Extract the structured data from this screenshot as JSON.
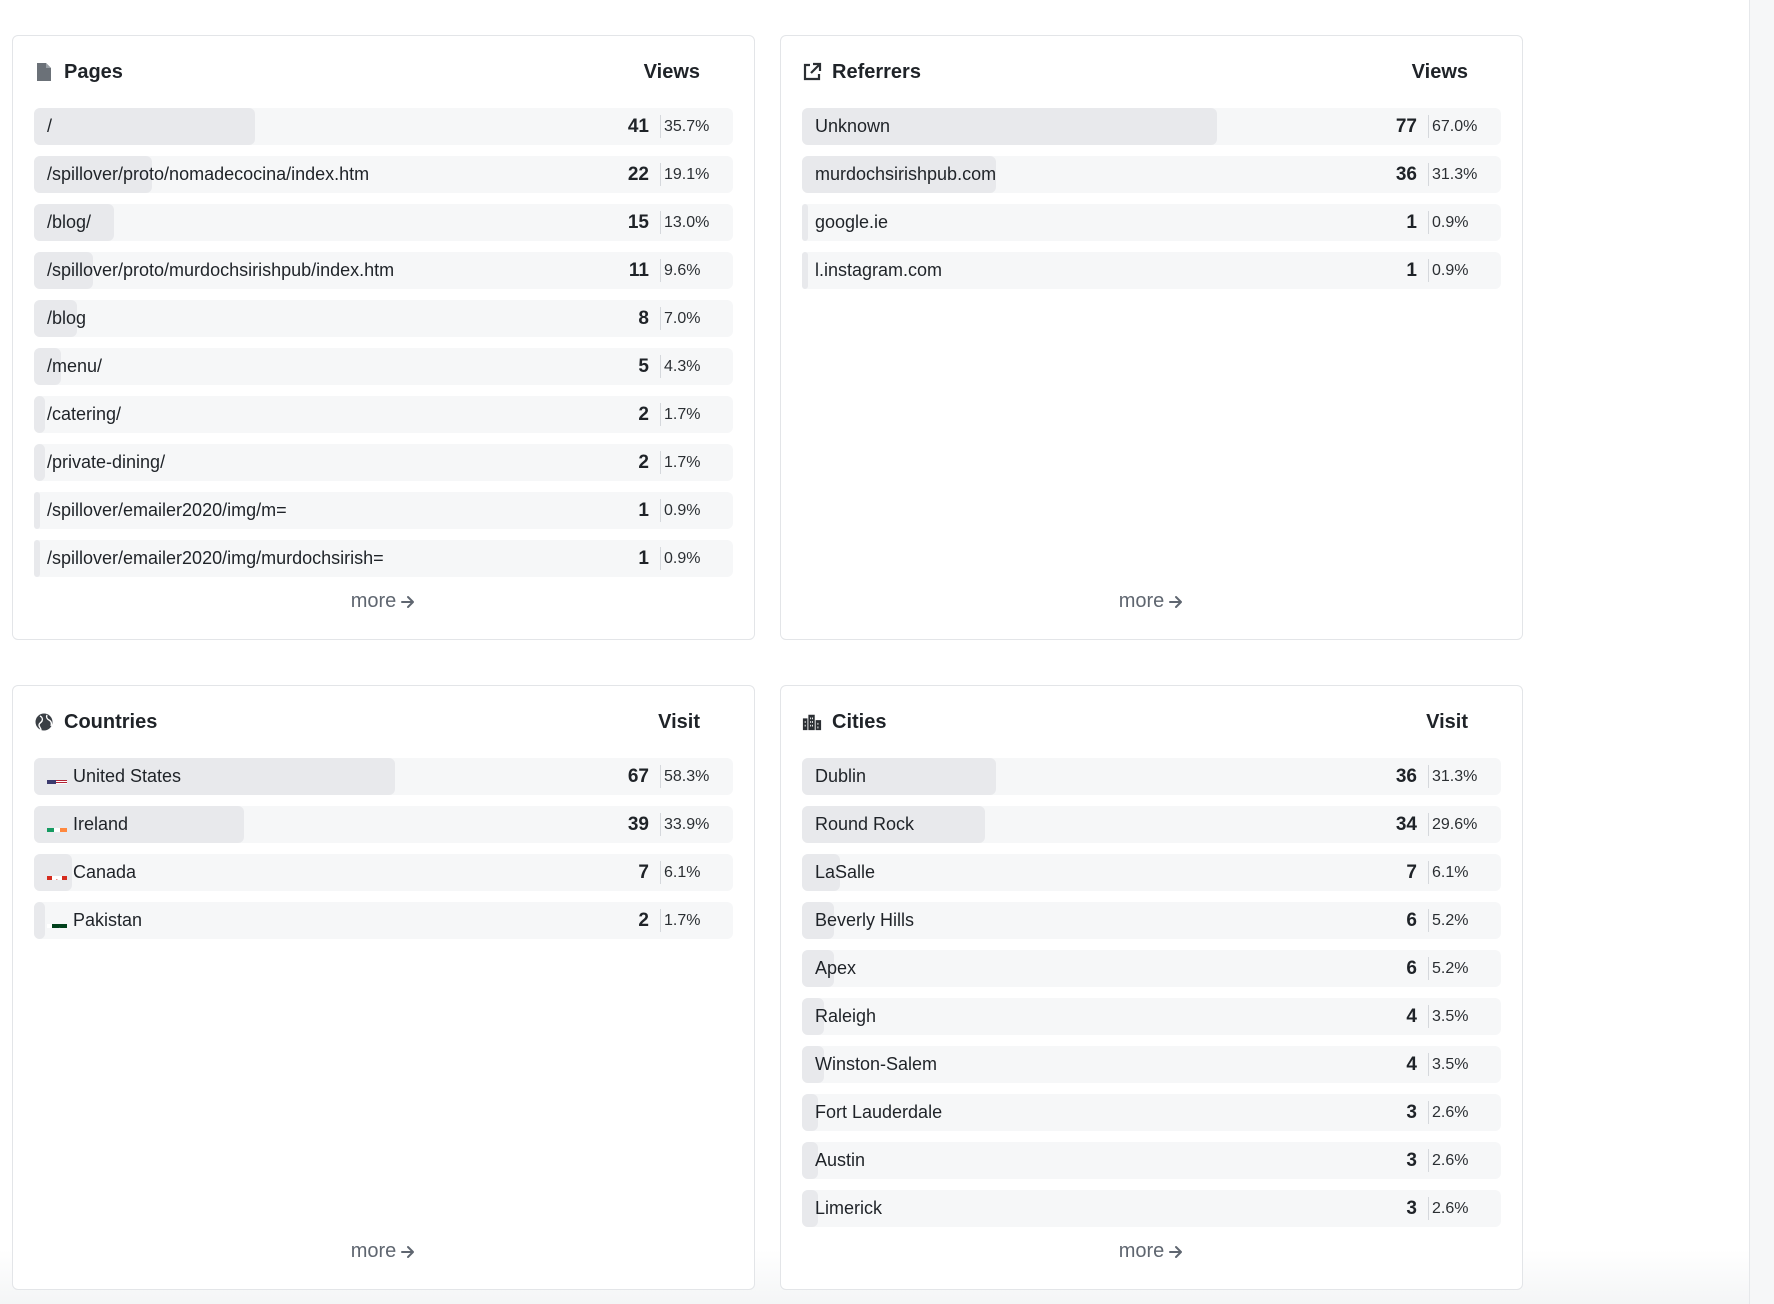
{
  "pages": {
    "title": "Pages",
    "icon": "document-icon",
    "column_label": "Views",
    "more_label": "more",
    "rows": [
      {
        "label": "/",
        "count": "41",
        "pct": "35.7%",
        "share": 0.357
      },
      {
        "label": "/spillover/proto/nomadecocina/index.htm",
        "count": "22",
        "pct": "19.1%",
        "share": 0.191
      },
      {
        "label": "/blog/",
        "count": "15",
        "pct": "13.0%",
        "share": 0.13
      },
      {
        "label": "/spillover/proto/murdochsirishpub/index.htm",
        "count": "11",
        "pct": "9.6%",
        "share": 0.096
      },
      {
        "label": "/blog",
        "count": "8",
        "pct": "7.0%",
        "share": 0.07
      },
      {
        "label": "/menu/",
        "count": "5",
        "pct": "4.3%",
        "share": 0.043
      },
      {
        "label": "/catering/",
        "count": "2",
        "pct": "1.7%",
        "share": 0.017
      },
      {
        "label": "/private-dining/",
        "count": "2",
        "pct": "1.7%",
        "share": 0.017
      },
      {
        "label": "/spillover/emailer2020/img/m=",
        "count": "1",
        "pct": "0.9%",
        "share": 0.009
      },
      {
        "label": "/spillover/emailer2020/img/murdochsirish=",
        "count": "1",
        "pct": "0.9%",
        "share": 0.009
      }
    ]
  },
  "referrers": {
    "title": "Referrers",
    "icon": "external-link-icon",
    "column_label": "Views",
    "more_label": "more",
    "rows": [
      {
        "label": "Unknown",
        "count": "77",
        "pct": "67.0%",
        "share": 0.67
      },
      {
        "label": "murdochsirishpub.com",
        "count": "36",
        "pct": "31.3%",
        "share": 0.313
      },
      {
        "label": "google.ie",
        "count": "1",
        "pct": "0.9%",
        "share": 0.009
      },
      {
        "label": "l.instagram.com",
        "count": "1",
        "pct": "0.9%",
        "share": 0.009
      }
    ]
  },
  "countries": {
    "title": "Countries",
    "icon": "globe-icon",
    "column_label": "Visit",
    "more_label": "more",
    "rows": [
      {
        "label": "United States",
        "flag": "us",
        "count": "67",
        "pct": "58.3%",
        "share": 0.583
      },
      {
        "label": "Ireland",
        "flag": "ie",
        "count": "39",
        "pct": "33.9%",
        "share": 0.339
      },
      {
        "label": "Canada",
        "flag": "ca",
        "count": "7",
        "pct": "6.1%",
        "share": 0.061
      },
      {
        "label": "Pakistan",
        "flag": "pk",
        "count": "2",
        "pct": "1.7%",
        "share": 0.017
      }
    ]
  },
  "cities": {
    "title": "Cities",
    "icon": "city-icon",
    "column_label": "Visit",
    "more_label": "more",
    "rows": [
      {
        "label": "Dublin",
        "count": "36",
        "pct": "31.3%",
        "share": 0.313
      },
      {
        "label": "Round Rock",
        "count": "34",
        "pct": "29.6%",
        "share": 0.296
      },
      {
        "label": "LaSalle",
        "count": "7",
        "pct": "6.1%",
        "share": 0.061
      },
      {
        "label": "Beverly Hills",
        "count": "6",
        "pct": "5.2%",
        "share": 0.052
      },
      {
        "label": "Apex",
        "count": "6",
        "pct": "5.2%",
        "share": 0.052
      },
      {
        "label": "Raleigh",
        "count": "4",
        "pct": "3.5%",
        "share": 0.035
      },
      {
        "label": "Winston-Salem",
        "count": "4",
        "pct": "3.5%",
        "share": 0.035
      },
      {
        "label": "Fort Lauderdale",
        "count": "3",
        "pct": "2.6%",
        "share": 0.026
      },
      {
        "label": "Austin",
        "count": "3",
        "pct": "2.6%",
        "share": 0.026
      },
      {
        "label": "Limerick",
        "count": "3",
        "pct": "2.6%",
        "share": 0.026
      }
    ]
  },
  "colors": {
    "row_background": "#f6f7f8",
    "bar_fill": "#e8e9ec",
    "text": "#1f2328",
    "muted": "#5f6670"
  }
}
